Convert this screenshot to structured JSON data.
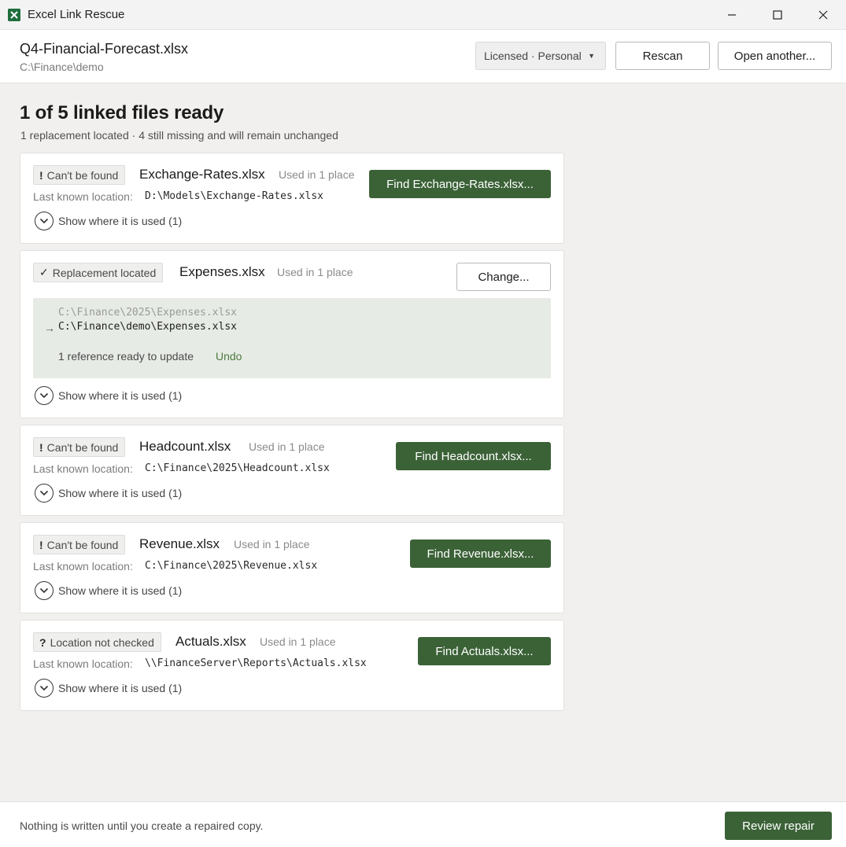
{
  "window": {
    "app_icon": "excel-icon",
    "title": "Excel Link Rescue"
  },
  "header": {
    "file_name": "Q4-Financial-Forecast.xlsx",
    "file_path": "C:\\Finance\\demo",
    "license_label": "Licensed · Personal",
    "rescan_label": "Rescan",
    "open_another_label": "Open another..."
  },
  "summary": {
    "title": "1 of 5 linked files ready",
    "subtitle": "1 replacement located · 4 still missing and will remain unchanged"
  },
  "links": [
    {
      "status_mark": "!",
      "status": "Can't be found",
      "name": "Exchange-Rates.xlsx",
      "used_in": "Used in 1 place",
      "location_label": "Last known location:",
      "location": "D:\\Models\\Exchange-Rates.xlsx",
      "action_label": "Find Exchange-Rates.xlsx...",
      "show_used_label": "Show where it is used (1)"
    },
    {
      "status_mark": "✓",
      "status": "Replacement located",
      "name": "Expenses.xlsx",
      "used_in": "Used in 1 place",
      "change_label": "Change...",
      "old_path": "C:\\Finance\\2025\\Expenses.xlsx",
      "arrow": "→",
      "new_path": "C:\\Finance\\demo\\Expenses.xlsx",
      "ready_text": "1 reference ready to update",
      "undo_label": "Undo",
      "show_used_label": "Show where it is used (1)"
    },
    {
      "status_mark": "!",
      "status": "Can't be found",
      "name": "Headcount.xlsx",
      "used_in": "Used in 1 place",
      "location_label": "Last known location:",
      "location": "C:\\Finance\\2025\\Headcount.xlsx",
      "action_label": "Find Headcount.xlsx...",
      "show_used_label": "Show where it is used (1)"
    },
    {
      "status_mark": "!",
      "status": "Can't be found",
      "name": "Revenue.xlsx",
      "used_in": "Used in 1 place",
      "location_label": "Last known location:",
      "location": "C:\\Finance\\2025\\Revenue.xlsx",
      "action_label": "Find Revenue.xlsx...",
      "show_used_label": "Show where it is used (1)"
    },
    {
      "status_mark": "?",
      "status": "Location not checked",
      "name": "Actuals.xlsx",
      "used_in": "Used in 1 place",
      "location_label": "Last known location:",
      "location": "\\\\FinanceServer\\Reports\\Actuals.xlsx",
      "action_label": "Find Actuals.xlsx...",
      "show_used_label": "Show where it is used (1)"
    }
  ],
  "footer": {
    "note": "Nothing is written until you create a repaired copy.",
    "review_label": "Review repair"
  },
  "colors": {
    "accent": "#3b6237",
    "background": "#f1f0ee",
    "replacement_panel": "#e7ebe5"
  }
}
